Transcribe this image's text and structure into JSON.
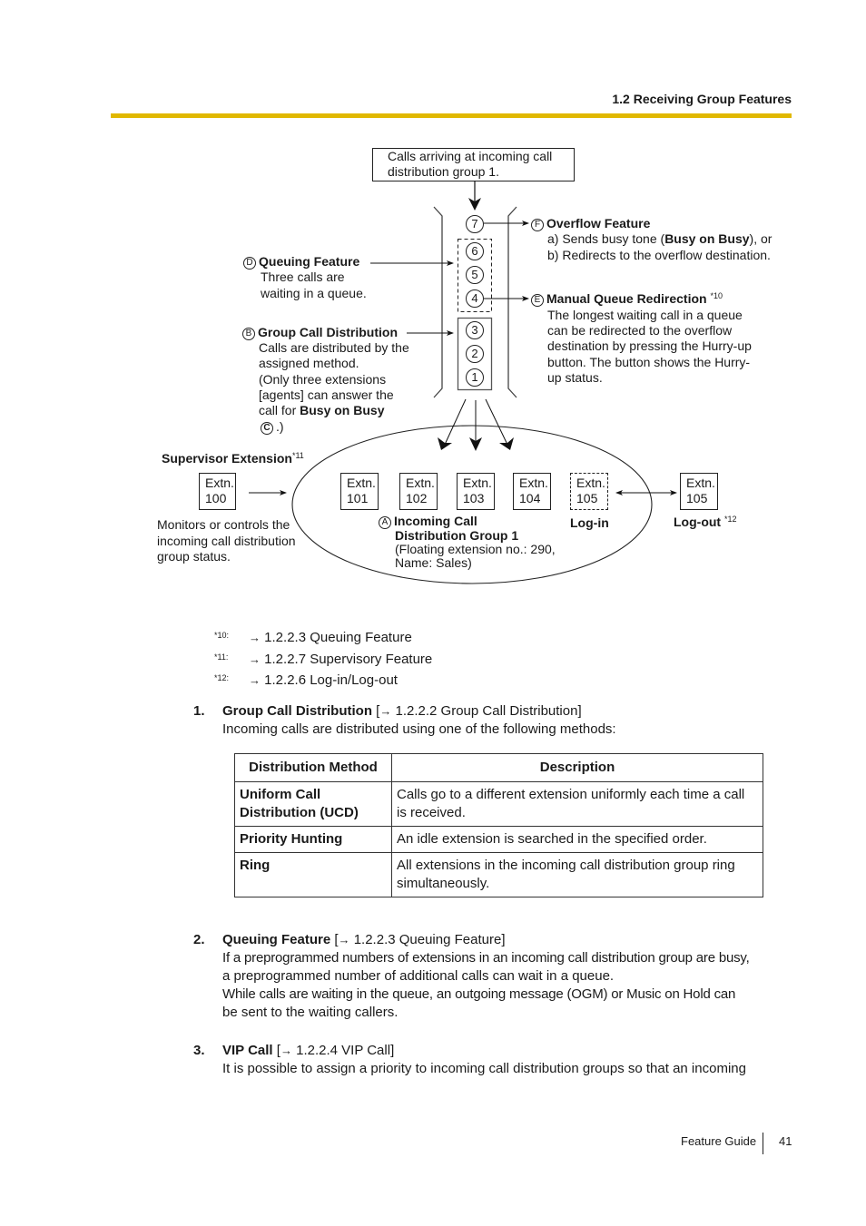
{
  "header": {
    "section_title": "1.2 Receiving Group Features"
  },
  "diagram": {
    "top_box": [
      "Calls arriving at incoming call",
      "distribution group 1."
    ],
    "queue_numbers": [
      "7",
      "6",
      "5",
      "4",
      "3",
      "2",
      "1"
    ],
    "overflow": {
      "marker": "F",
      "title": "Overflow Feature",
      "line1_pre": "a) Sends busy tone (",
      "line1_bold": "Busy on Busy",
      "line1_post": "), or",
      "line2": "b) Redirects to the overflow destination."
    },
    "manual_queue": {
      "marker": "E",
      "title": "Manual Queue Redirection",
      "ref": "*10",
      "lines": [
        "The longest waiting call in a queue",
        "can be redirected to the overflow",
        "destination by pressing the Hurry-up",
        "button. The button shows the Hurry-",
        "up status."
      ]
    },
    "queuing": {
      "marker": "D",
      "title": "Queuing Feature",
      "lines": [
        "Three calls are",
        "waiting in a queue."
      ]
    },
    "group_call": {
      "marker": "B",
      "title": "Group Call Distribution",
      "lines": [
        "Calls are distributed by the",
        "assigned method.",
        "(Only three extensions",
        "[agents] can answer the"
      ],
      "line5_pre": "call for ",
      "line5_bold": "Busy on Busy",
      "line6_marker": "C",
      "line6_post": ".)"
    },
    "supervisor": {
      "title": "Supervisor Extension",
      "ref": "*11",
      "extn_label": "Extn.",
      "extn_number": "100",
      "desc": [
        "Monitors or controls the",
        "incoming call distribution",
        "group status."
      ]
    },
    "group_extensions": [
      {
        "label": "Extn.",
        "number": "101"
      },
      {
        "label": "Extn.",
        "number": "102"
      },
      {
        "label": "Extn.",
        "number": "103"
      },
      {
        "label": "Extn.",
        "number": "104"
      },
      {
        "label": "Extn.",
        "number": "105"
      }
    ],
    "login_label": "Log-in",
    "logout": {
      "label": "Log-out",
      "ref": "*12",
      "extn_label": "Extn.",
      "extn_number": "105"
    },
    "group": {
      "marker": "A",
      "title_line1": "Incoming Call",
      "title_line2": "Distribution Group 1",
      "detail_line1": "(Floating extension no.: 290,",
      "detail_line2": "Name: Sales)"
    }
  },
  "references": [
    {
      "mark": "*10:",
      "text": "1.2.2.3 Queuing Feature"
    },
    {
      "mark": "*11:",
      "text": "1.2.2.7 Supervisory Feature"
    },
    {
      "mark": "*12:",
      "text": "1.2.2.6 Log-in/Log-out"
    }
  ],
  "arrow_glyph": "→",
  "items": [
    {
      "number": "1.",
      "title": "Group Call Distribution",
      "ref": "1.2.2.2 Group Call Distribution",
      "body": [
        "Incoming calls are distributed using one of the following methods:"
      ]
    },
    {
      "number": "2.",
      "title": "Queuing Feature",
      "ref": "1.2.2.3 Queuing Feature",
      "body": [
        "If a preprogrammed numbers of extensions in an incoming call distribution group are busy,",
        "a preprogrammed number of additional calls can wait in a queue.",
        "While calls are waiting in the queue, an outgoing message (OGM) or Music on Hold can",
        "be sent to the waiting callers."
      ]
    },
    {
      "number": "3.",
      "title": "VIP Call",
      "ref": "1.2.2.4 VIP Call",
      "body": [
        "It is possible to assign a priority to incoming call distribution groups so that an incoming"
      ]
    }
  ],
  "table": {
    "headers": [
      "Distribution Method",
      "Description"
    ],
    "rows": [
      {
        "method": "Uniform Call Distribution (UCD)",
        "description": "Calls go to a different extension uniformly each time a call is received."
      },
      {
        "method": "Priority Hunting",
        "description": "An idle extension is searched in the specified order."
      },
      {
        "method": "Ring",
        "description": "All extensions in the incoming call distribution group ring simultaneously."
      }
    ]
  },
  "footer": {
    "guide": "Feature Guide",
    "page": "41"
  },
  "colors": {
    "accent_rule": "#e0b800"
  }
}
